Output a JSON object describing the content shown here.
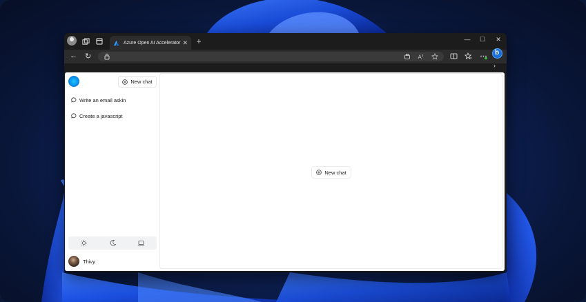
{
  "browser": {
    "tab_title": "Azure Open AI Accelerator"
  },
  "sidebar": {
    "new_chat_label": "New chat",
    "history": [
      {
        "label": "Write an email askin"
      },
      {
        "label": "Create a javascript"
      }
    ],
    "theme_options": [
      "sun-icon",
      "moon-icon",
      "laptop-icon"
    ],
    "user": {
      "name": "Thivy"
    }
  },
  "main": {
    "new_chat_label": "New chat"
  },
  "colors": {
    "accent": "#0a8ee8",
    "browser_dark": "#1c1c1c",
    "copilot_blue": "#1d6fd8"
  }
}
